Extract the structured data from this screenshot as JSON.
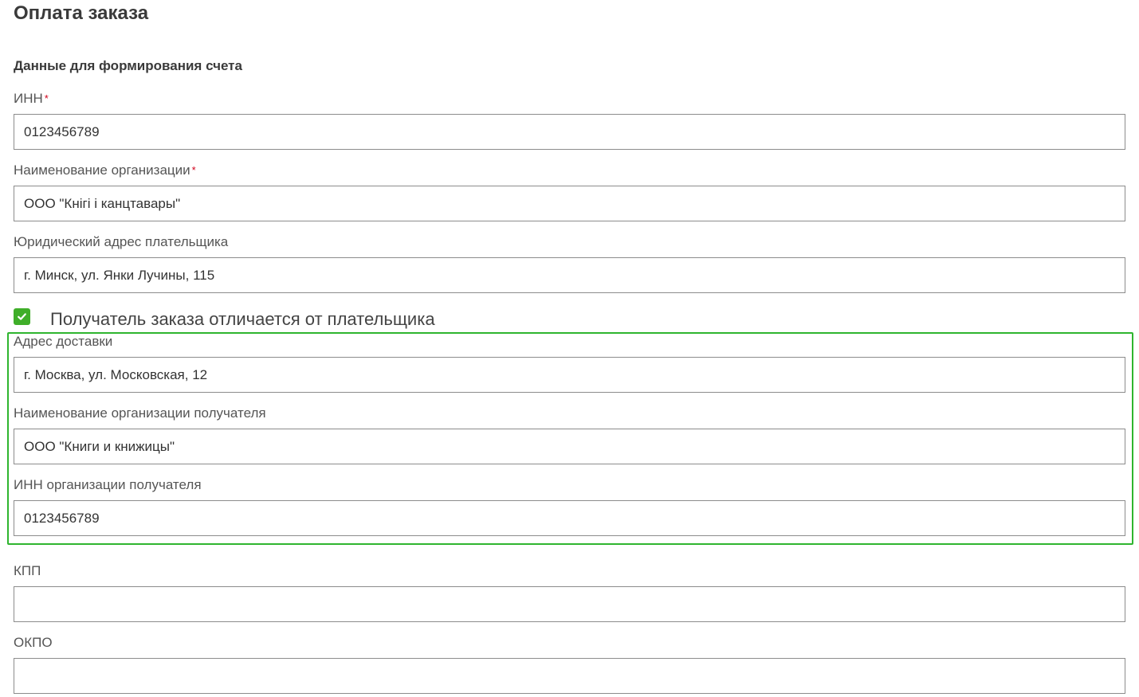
{
  "page": {
    "title": "Оплата заказа",
    "section_title": "Данные для формирования счета"
  },
  "colors": {
    "accent_green": "#3fae29",
    "highlight_border": "#2fb52f",
    "required_star": "#d0021b"
  },
  "payer": {
    "inn": {
      "label": "ИНН",
      "required_mark": "*",
      "value": "0123456789"
    },
    "org_name": {
      "label": "Наименование организации",
      "required_mark": "*",
      "value": "ООО \"Кнігі і канцтавары\""
    },
    "legal_address": {
      "label": "Юридический адрес плательщика",
      "value": "г. Минск, ул. Янки Лучины, 115"
    }
  },
  "recipient_toggle": {
    "checked": true,
    "label": "Получатель заказа отличается от плательщика"
  },
  "recipient": {
    "delivery_address": {
      "label": "Адрес доставки",
      "value": "г. Москва, ул. Московская, 12"
    },
    "org_name": {
      "label": "Наименование организации получателя",
      "value": "ООО \"Книги и книжицы\""
    },
    "inn": {
      "label": "ИНН организации получателя",
      "value": "0123456789"
    }
  },
  "extra": {
    "kpp": {
      "label": "КПП",
      "value": ""
    },
    "okpo": {
      "label": "ОКПО",
      "value": ""
    }
  }
}
